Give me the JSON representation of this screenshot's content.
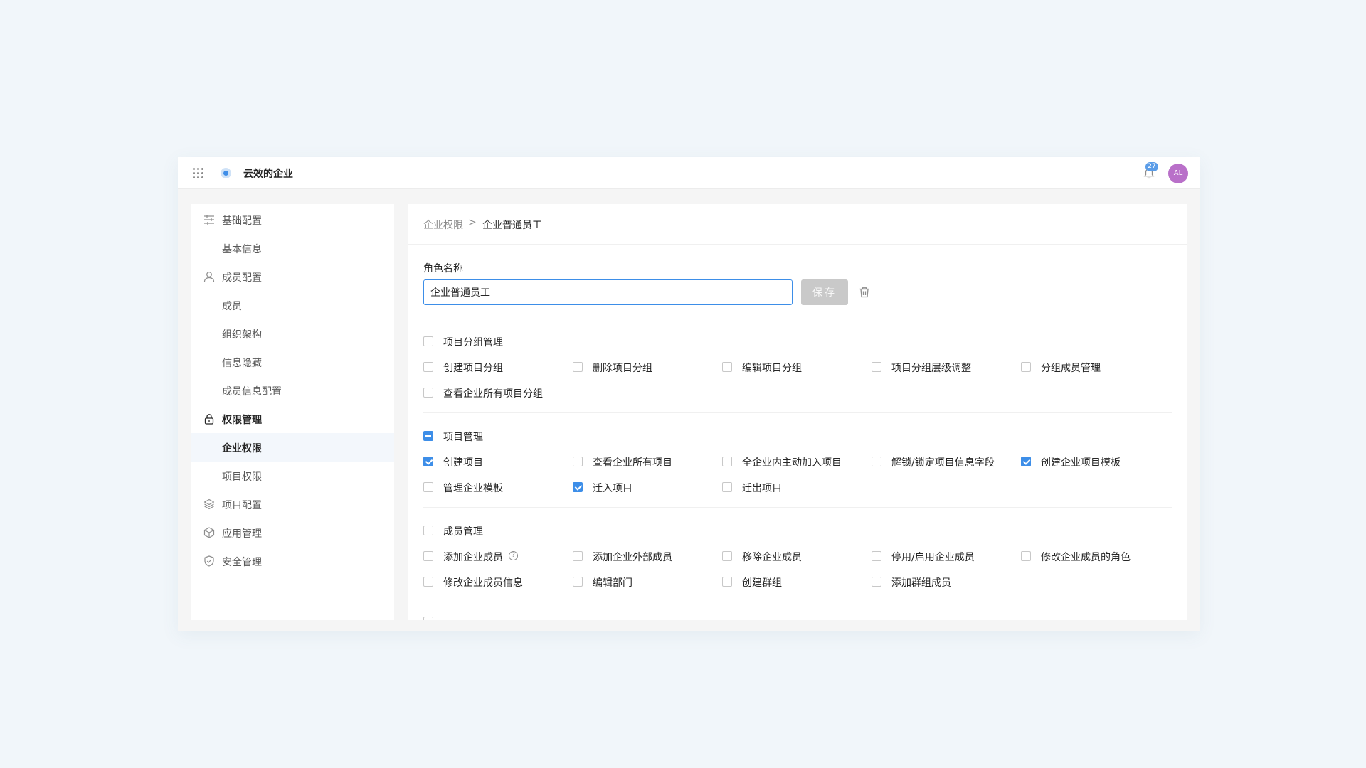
{
  "topbar": {
    "org_name": "云效的企业",
    "notification_count": "27",
    "avatar_initials": "AL"
  },
  "sidebar": {
    "items": [
      {
        "label": "基础配置",
        "icon": "sliders-icon",
        "kind": "group"
      },
      {
        "label": "基本信息",
        "kind": "child"
      },
      {
        "label": "成员配置",
        "icon": "user-icon",
        "kind": "group"
      },
      {
        "label": "成员",
        "kind": "child"
      },
      {
        "label": "组织架构",
        "kind": "child"
      },
      {
        "label": "信息隐藏",
        "kind": "child"
      },
      {
        "label": "成员信息配置",
        "kind": "child"
      },
      {
        "label": "权限管理",
        "icon": "lock-icon",
        "kind": "group-bold"
      },
      {
        "label": "企业权限",
        "kind": "child-active"
      },
      {
        "label": "项目权限",
        "kind": "child"
      },
      {
        "label": "项目配置",
        "icon": "layers-icon",
        "kind": "group"
      },
      {
        "label": "应用管理",
        "icon": "cube-icon",
        "kind": "group"
      },
      {
        "label": "安全管理",
        "icon": "shield-check-icon",
        "kind": "group"
      }
    ]
  },
  "breadcrumb": {
    "parent": "企业权限",
    "separator": ">",
    "current": "企业普通员工"
  },
  "role": {
    "label": "角色名称",
    "value": "企业普通员工",
    "save_label": "保存"
  },
  "sections": [
    {
      "title": "项目分组管理",
      "state": "unchecked",
      "permissions": [
        {
          "label": "创建项目分组",
          "checked": false
        },
        {
          "label": "删除项目分组",
          "checked": false
        },
        {
          "label": "编辑项目分组",
          "checked": false
        },
        {
          "label": "项目分组层级调整",
          "checked": false
        },
        {
          "label": "分组成员管理",
          "checked": false
        },
        {
          "label": "查看企业所有项目分组",
          "checked": false
        }
      ]
    },
    {
      "title": "项目管理",
      "state": "partial",
      "permissions": [
        {
          "label": "创建项目",
          "checked": true
        },
        {
          "label": "查看企业所有项目",
          "checked": false
        },
        {
          "label": "全企业内主动加入项目",
          "checked": false
        },
        {
          "label": "解锁/锁定项目信息字段",
          "checked": false
        },
        {
          "label": "创建企业项目模板",
          "checked": true
        },
        {
          "label": "管理企业模板",
          "checked": false
        },
        {
          "label": "迁入项目",
          "checked": true
        },
        {
          "label": "迁出项目",
          "checked": false
        }
      ]
    },
    {
      "title": "成员管理",
      "state": "unchecked",
      "permissions": [
        {
          "label": "添加企业成员",
          "checked": false,
          "help": true
        },
        {
          "label": "添加企业外部成员",
          "checked": false
        },
        {
          "label": "移除企业成员",
          "checked": false
        },
        {
          "label": "停用/启用企业成员",
          "checked": false
        },
        {
          "label": "修改企业成员的角色",
          "checked": false
        },
        {
          "label": "修改企业成员信息",
          "checked": false
        },
        {
          "label": "编辑部门",
          "checked": false
        },
        {
          "label": "创建群组",
          "checked": false
        },
        {
          "label": "添加群组成员",
          "checked": false
        }
      ]
    }
  ],
  "colors": {
    "accent": "#3d8ee8",
    "page_bg": "#f1f6fa",
    "avatar": "#b970c9",
    "save_disabled": "#c9c9c9"
  }
}
